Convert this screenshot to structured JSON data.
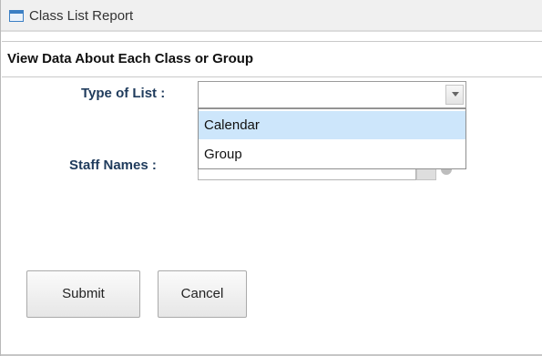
{
  "window": {
    "title": "Class List Report"
  },
  "section": {
    "heading": "View Data About Each Class or Group"
  },
  "form": {
    "type_of_list_label": "Type of List :",
    "type_of_list_value": "",
    "type_of_list_options": [
      "Calendar",
      "Group"
    ],
    "highlighted_option": "Calendar",
    "staff_names_label": "Staff Names :",
    "staff_names_value": ""
  },
  "buttons": {
    "submit": "Submit",
    "cancel": "Cancel"
  },
  "colors": {
    "label_text": "#1f3b5c",
    "option_highlight": "#cde6fb",
    "title_icon": "#3b7fc4"
  },
  "icons": {
    "window": "window-icon",
    "dropdown": "chevron-down-icon",
    "info": "info-icon"
  }
}
